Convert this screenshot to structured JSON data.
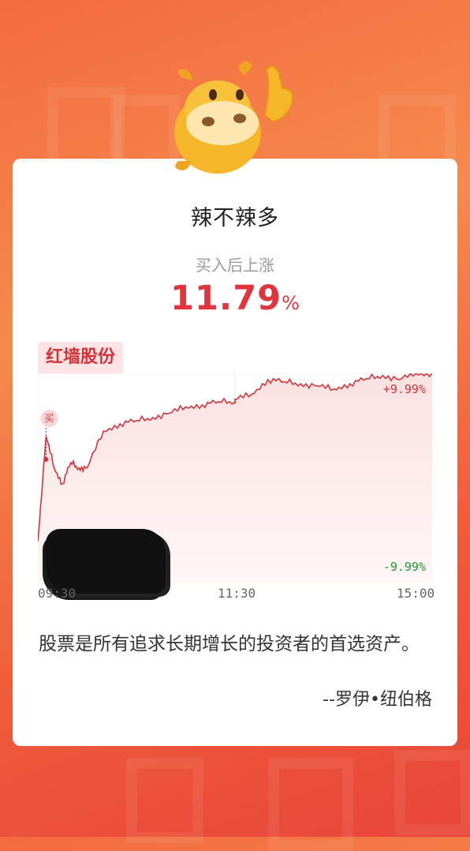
{
  "card": {
    "title": "辣不辣多",
    "subtitle": "买入后上涨",
    "gain_value": "11.79",
    "gain_unit": "%"
  },
  "stock": {
    "name": "红墙股份",
    "buy_marker": "买",
    "limit_up": "+9.99%",
    "limit_down": "-9.99%"
  },
  "chart_data": {
    "type": "line",
    "x_ticks": [
      "09:30",
      "11:30",
      "15:00"
    ],
    "ylim_pct": [
      -9.99,
      9.99
    ],
    "series": [
      {
        "x": [
          "09:30",
          "09:35",
          "09:40",
          "09:45",
          "09:50",
          "09:55",
          "10:00",
          "10:10",
          "10:20",
          "10:30",
          "10:40",
          "10:50",
          "11:00",
          "11:10",
          "11:20",
          "11:30",
          "13:00",
          "13:10",
          "13:20",
          "13:30",
          "13:40",
          "13:50",
          "14:00",
          "14:10",
          "14:20",
          "14:30",
          "14:40",
          "14:50",
          "15:00"
        ],
        "values": [
          -6.0,
          4.0,
          1.0,
          -0.5,
          1.5,
          1.0,
          1.0,
          4.5,
          5.2,
          5.5,
          5.8,
          6.2,
          6.8,
          7.0,
          7.3,
          7.3,
          7.5,
          8.0,
          9.4,
          9.2,
          9.0,
          8.8,
          8.5,
          9.0,
          9.5,
          9.8,
          9.4,
          9.99,
          9.99
        ]
      }
    ],
    "buy_point": {
      "x": "09:35",
      "value": 1.8
    },
    "colors": {
      "line": "#d6323a",
      "fill": "#fde8e8",
      "down": "#1a9c2e"
    }
  },
  "quote": {
    "text": "股票是所有追求长期增长的投资者的首选资产。",
    "author": "--罗伊•纽伯格"
  }
}
